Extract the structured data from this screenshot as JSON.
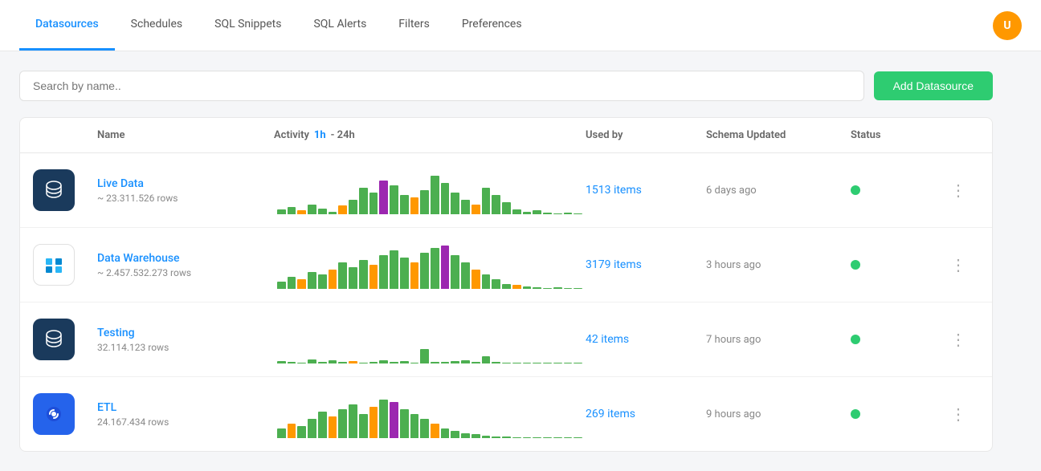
{
  "nav": {
    "tabs": [
      {
        "label": "Datasources",
        "active": true
      },
      {
        "label": "Schedules",
        "active": false
      },
      {
        "label": "SQL Snippets",
        "active": false
      },
      {
        "label": "SQL Alerts",
        "active": false
      },
      {
        "label": "Filters",
        "active": false
      },
      {
        "label": "Preferences",
        "active": false
      }
    ]
  },
  "toolbar": {
    "search_placeholder": "Search by name..",
    "add_button_label": "Add Datasource"
  },
  "table": {
    "columns": {
      "name": "Name",
      "activity": "Activity",
      "activity_toggle": "1h",
      "activity_separator": "- 24h",
      "used_by": "Used by",
      "schema_updated": "Schema Updated",
      "status": "Status"
    },
    "rows": [
      {
        "id": "live-data",
        "name": "Live Data",
        "rows_count": "~ 23.311.526 rows",
        "used_by": "1513 items",
        "schema_updated": "6 days ago",
        "icon_type": "postgres",
        "icon_bg": "#1a3a5c",
        "status": "active"
      },
      {
        "id": "data-warehouse",
        "name": "Data Warehouse",
        "rows_count": "~ 2.457.532.273 rows",
        "used_by": "3179 items",
        "schema_updated": "3 hours ago",
        "icon_type": "redshift",
        "icon_bg": "#ffffff",
        "status": "active"
      },
      {
        "id": "testing",
        "name": "Testing",
        "rows_count": "32.114.123 rows",
        "used_by": "42 items",
        "schema_updated": "7 hours ago",
        "icon_type": "postgres",
        "icon_bg": "#1a3a5c",
        "status": "active"
      },
      {
        "id": "etl",
        "name": "ETL",
        "rows_count": "24.167.434 rows",
        "used_by": "269 items",
        "schema_updated": "9 hours ago",
        "icon_type": "metabase",
        "icon_bg": "#2563eb",
        "status": "active"
      }
    ]
  }
}
